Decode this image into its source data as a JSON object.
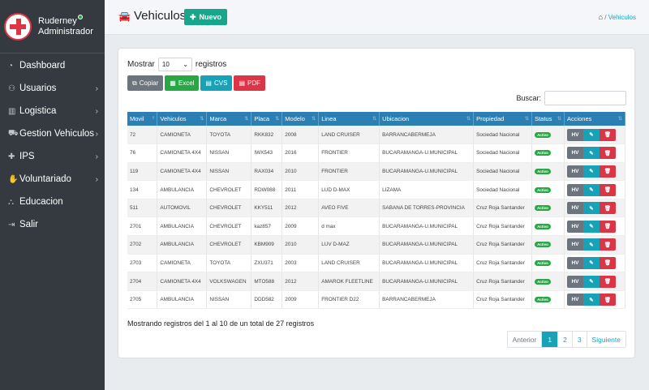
{
  "sidebar": {
    "user_name": "Ruderney",
    "user_role": "Administrador",
    "items": [
      {
        "label": "Dashboard",
        "icon": "dashboard-icon",
        "glyph": "◔",
        "chevron": false
      },
      {
        "label": "Usuarios",
        "icon": "users-icon",
        "glyph": "⚇",
        "chevron": true
      },
      {
        "label": "Logistica",
        "icon": "chart-icon",
        "glyph": "▥",
        "chevron": true
      },
      {
        "label": "Gestion Vehiculos",
        "icon": "car-icon",
        "glyph": "⛟",
        "chevron": true
      },
      {
        "label": "IPS",
        "icon": "medkit-icon",
        "glyph": "✚",
        "chevron": true
      },
      {
        "label": "Voluntariado",
        "icon": "hands-icon",
        "glyph": "✋",
        "chevron": true
      },
      {
        "label": "Educacion",
        "icon": "cart-icon",
        "glyph": "⛬",
        "chevron": false
      },
      {
        "label": "Salir",
        "icon": "logout-icon",
        "glyph": "⇥",
        "chevron": false
      }
    ]
  },
  "header": {
    "title": "Vehiculos",
    "new_button": "Nuevo",
    "breadcrumb_sep": "/",
    "breadcrumb_active": "Vehiculos"
  },
  "controls": {
    "show_label": "Mostrar",
    "show_value": "10",
    "records_label": "registros",
    "search_label": "Buscar:",
    "export_buttons": [
      {
        "label": "Copiar",
        "color": "#6c757d"
      },
      {
        "label": "Excel",
        "color": "#28a745"
      },
      {
        "label": "CVS",
        "color": "#17a2b8"
      },
      {
        "label": "PDF",
        "color": "#dc3545"
      }
    ]
  },
  "table": {
    "columns": [
      "Movil",
      "Vehiculos",
      "Marca",
      "Placa",
      "Modelo",
      "Linea",
      "Ubicacion",
      "Propiedad",
      "Status",
      "Acciones"
    ],
    "rows": [
      [
        "72",
        "CAMIONETA",
        "TOYOTA",
        "RKK832",
        "2008",
        "LAND CRUISER",
        "BARRANCABERMEJA",
        "Sociedad Nacional",
        "Activo"
      ],
      [
        "76",
        "CAMIONETA 4X4",
        "NISSAN",
        "IWX543",
        "2016",
        "FRONTIER",
        "BUCARAMANGA-U.MUNICIPAL",
        "Sociedad Nacional",
        "Activo"
      ],
      [
        "119",
        "CAMIONETA 4X4",
        "NISSAN",
        "RAX034",
        "2010",
        "FRONTIER",
        "BUCARAMANGA-U.MUNICIPAL",
        "Sociedad Nacional",
        "Activo"
      ],
      [
        "134",
        "AMBULANCIA",
        "CHEVROLET",
        "RDW088",
        "2011",
        "LUD D-MAX",
        "LIZAMA",
        "Sociedad Nacional",
        "Activo"
      ],
      [
        "511",
        "AUTOMOVIL",
        "CHEVROLET",
        "KKY511",
        "2012",
        "AVEO FIVE",
        "SABANA DE TORRES-PROVINCIA",
        "Cruz Roja Santander",
        "Activo"
      ],
      [
        "2701",
        "AMBULANCIA",
        "CHEVROLET",
        "kaz857",
        "2009",
        "d max",
        "BUCARAMANGA-U.MUNICIPAL",
        "Cruz Roja Santander",
        "Activo"
      ],
      [
        "2702",
        "AMBULANCIA",
        "CHEVROLET",
        "KBM909",
        "2010",
        "LUV D-MAZ",
        "BUCARAMANGA-U.MUNICIPAL",
        "Cruz Roja Santander",
        "Activo"
      ],
      [
        "2703",
        "CAMIONETA",
        "TOYOTA",
        "ZXU371",
        "2003",
        "LAND CRUISER",
        "BUCARAMANGA-U.MUNICIPAL",
        "Cruz Roja Santander",
        "Activo"
      ],
      [
        "2704",
        "CAMIONETA 4X4",
        "VOLKSWAGEN",
        "MTO588",
        "2012",
        "AMAROK FLEETLINE",
        "BUCARAMANGA-U.MUNICIPAL",
        "Cruz Roja Santander",
        "Activo"
      ],
      [
        "2705",
        "AMBULANCIA",
        "NISSAN",
        "DDD582",
        "2009",
        "FRONTIER D22",
        "BARRANCABERMEJA",
        "Cruz Roja Santander",
        "Activo"
      ]
    ],
    "action_hv": "HV"
  },
  "footer": {
    "info": "Mostrando registros del 1 al 10 de un total de 27 registros",
    "pagination": {
      "prev": "Anterior",
      "pages": [
        "1",
        "2",
        "3"
      ],
      "next": "Siguiente"
    }
  }
}
